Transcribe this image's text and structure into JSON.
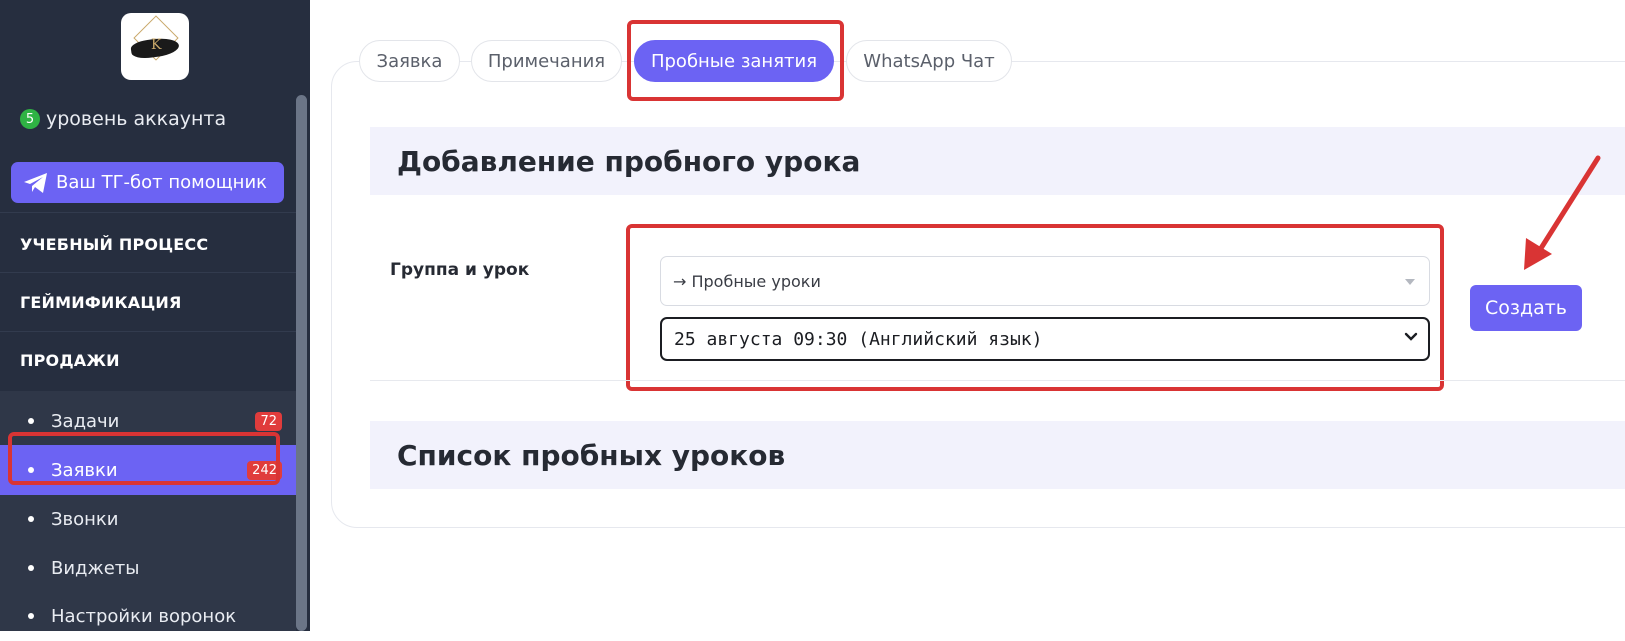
{
  "sidebar": {
    "level": {
      "number": "5",
      "label": "уровень аккаунта"
    },
    "tg_button": "Ваш ТГ-бот помощник",
    "sections": [
      "УЧЕБНЫЙ ПРОЦЕСС",
      "ГЕЙМИФИКАЦИЯ",
      "ПРОДАЖИ"
    ],
    "items": [
      {
        "label": "Задачи",
        "badge": "72"
      },
      {
        "label": "Заявки",
        "badge": "242"
      },
      {
        "label": "Звонки"
      },
      {
        "label": "Виджеты"
      },
      {
        "label": "Настройки воронок"
      }
    ]
  },
  "tabs": [
    {
      "label": "Заявка"
    },
    {
      "label": "Примечания"
    },
    {
      "label": "Пробные занятия"
    },
    {
      "label": "WhatsApp Чат"
    }
  ],
  "add_section": {
    "title": "Добавление пробного урока",
    "field_label": "Группа и урок",
    "group_select": "→ Пробные уроки",
    "lesson_select": "25 августа 09:30 (Английский язык)",
    "create_button": "Создать"
  },
  "list_section": {
    "title": "Список пробных уроков"
  },
  "colors": {
    "accent": "#6c63f3",
    "sidebar": "#262e3f",
    "highlight": "#d93434",
    "badge": "#e03c3c"
  }
}
